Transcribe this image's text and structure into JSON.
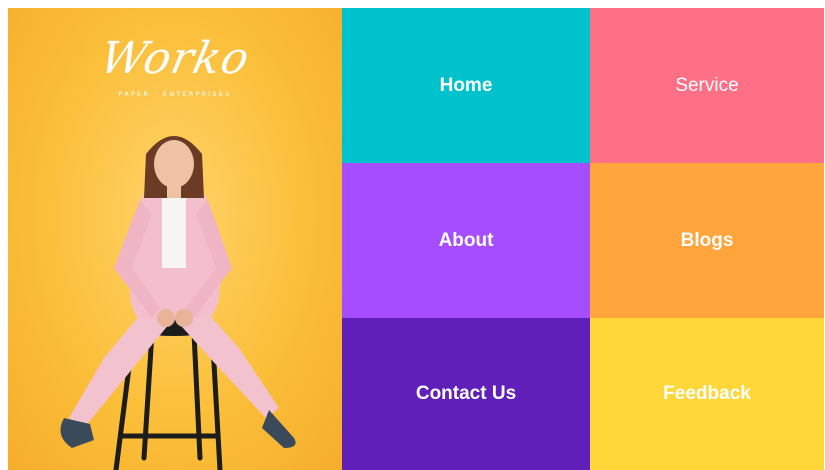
{
  "brand": {
    "name": "Worko",
    "tagline": "PAPER · ENTERPRISES"
  },
  "nav": [
    {
      "label": "Home",
      "color": "#00c2cc"
    },
    {
      "label": "Service",
      "color": "#ff7087"
    },
    {
      "label": "About",
      "color": "#a54dff"
    },
    {
      "label": "Blogs",
      "color": "#ffa53b"
    },
    {
      "label": "Contact Us",
      "color": "#5f1fb8"
    },
    {
      "label": "Feedback",
      "color": "#ffd738"
    }
  ],
  "hero": {
    "background": "#fbbf3a"
  }
}
